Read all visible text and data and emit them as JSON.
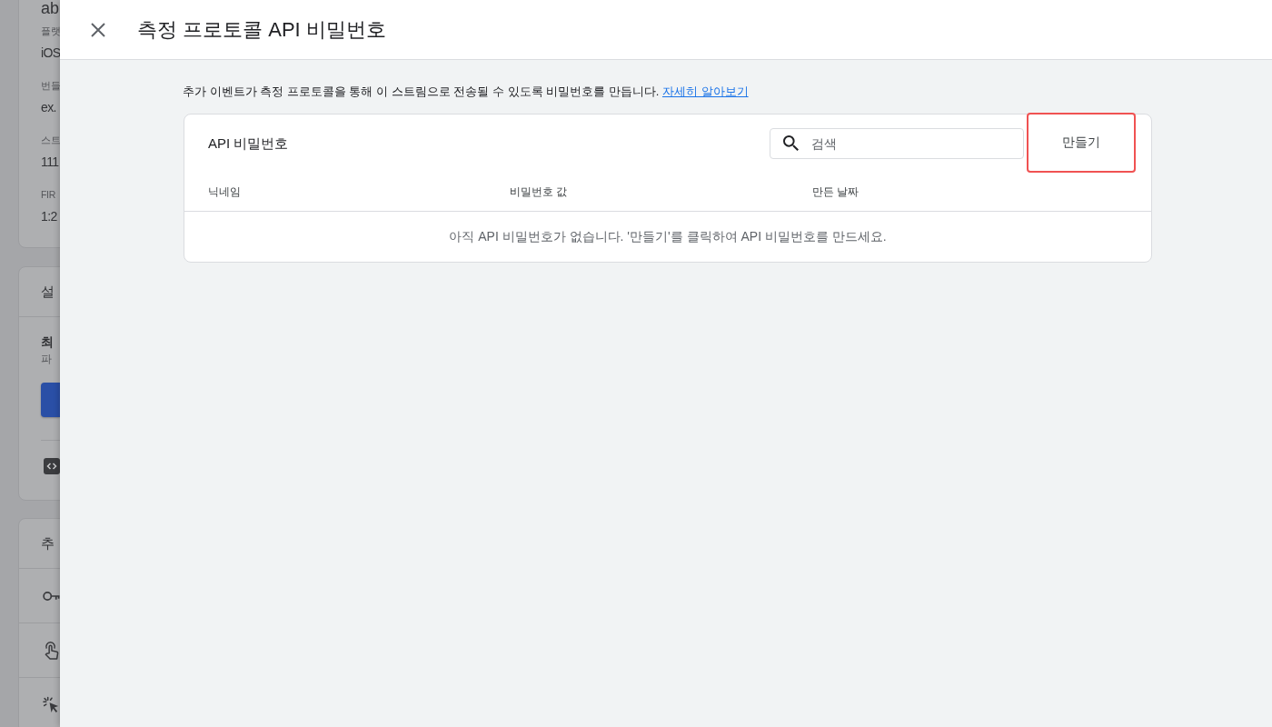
{
  "background_page": {
    "cards": [
      {
        "kind": "fields",
        "title": "ab",
        "fields": [
          {
            "label": "플랫",
            "value": "iOS"
          },
          {
            "label": "번들",
            "value": "ex."
          },
          {
            "label": "스트",
            "value": "111"
          },
          {
            "label": "FIR",
            "value": "1:2"
          }
        ]
      },
      {
        "kind": "setup",
        "title": "설",
        "heading": "최",
        "text": "파"
      },
      {
        "kind": "links",
        "title": "추"
      }
    ]
  },
  "dialog": {
    "title": "측정 프로토콜 API 비밀번호",
    "description": "추가 이벤트가 측정 프로토콜을 통해 이 스트림으로 전송될 수 있도록 비밀번호를 만듭니다.",
    "learn_more_link": "자세히 알아보기",
    "table_card": {
      "title": "API 비밀번호",
      "search": {
        "placeholder": "검색"
      },
      "create_button": {
        "label": "만들기",
        "highlighted": true
      },
      "columns": [
        "닉네임",
        "비밀번호 값",
        "만든 날짜"
      ],
      "empty_message": "아직 API 비밀번호가 없습니다. '만들기'를 클릭하여 API 비밀번호를 만드세요."
    }
  }
}
